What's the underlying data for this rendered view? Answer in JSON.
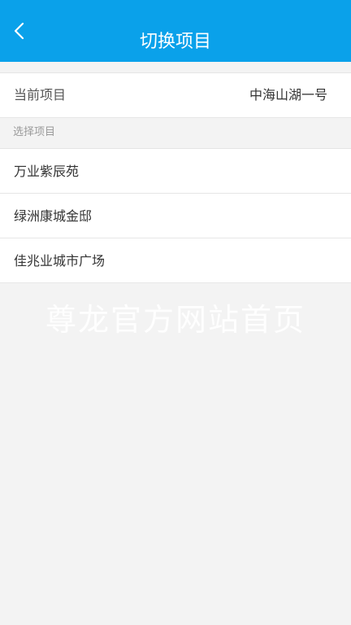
{
  "header": {
    "title": "切换项目",
    "back_icon": "chevron-left-icon"
  },
  "current": {
    "label": "当前项目",
    "value": "中海山湖一号"
  },
  "section": {
    "label": "选择项目"
  },
  "projects": [
    {
      "name": "万业紫辰苑"
    },
    {
      "name": "绿洲康城金邸"
    },
    {
      "name": "佳兆业城市广场"
    }
  ],
  "watermark": {
    "text": "尊龙官方网站首页"
  },
  "colors": {
    "header_bg": "#0aa1ea",
    "page_bg": "#f3f3f3"
  }
}
